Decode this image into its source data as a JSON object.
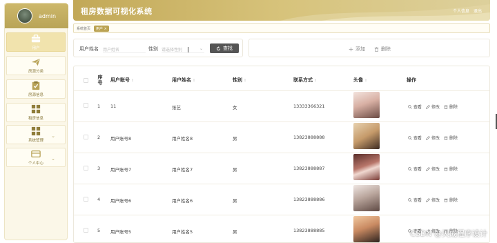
{
  "sidebar": {
    "username": "admin",
    "items": [
      {
        "label": "用户",
        "icon": "briefcase-icon"
      },
      {
        "label": "房源分类",
        "icon": "paper-plane-icon"
      },
      {
        "label": "房源信息",
        "icon": "clipboard-check-icon"
      },
      {
        "label": "租房信息",
        "icon": "grid-icon"
      },
      {
        "label": "系统管理",
        "icon": "grid-icon"
      },
      {
        "label": "个人中心",
        "icon": "card-icon"
      }
    ]
  },
  "header": {
    "title": "租房数据可视化系统",
    "profile_label": "个人信息",
    "logout_label": "退出"
  },
  "breadcrumb": {
    "home": "系统首页",
    "current_tag": "用户 ×"
  },
  "search": {
    "name_label": "用户姓名",
    "name_placeholder": "用户姓名",
    "gender_label": "性别",
    "gender_placeholder": "请选择性别",
    "search_button": "查找"
  },
  "actions": {
    "add": "添加",
    "delete": "删除"
  },
  "table": {
    "columns": [
      "序号",
      "用户账号",
      "用户姓名",
      "性别",
      "联系方式",
      "头像",
      "操作"
    ],
    "rows": [
      {
        "index": "1",
        "account": "11",
        "name": "张艺",
        "gender": "女",
        "phone": "13333366321",
        "avatar_color": "#d6a9a0"
      },
      {
        "index": "2",
        "account": "用户账号8",
        "name": "用户姓名8",
        "gender": "男",
        "phone": "13823888888",
        "avatar_color": "#c9a374"
      },
      {
        "index": "3",
        "account": "用户账号7",
        "name": "用户姓名7",
        "gender": "男",
        "phone": "13823888887",
        "avatar_color": "#7a3b35"
      },
      {
        "index": "4",
        "account": "用户账号6",
        "name": "用户姓名6",
        "gender": "男",
        "phone": "13823888886",
        "avatar_color": "#9b8c86"
      },
      {
        "index": "5",
        "account": "用户账号5",
        "name": "用户姓名5",
        "gender": "男",
        "phone": "13823888885",
        "avatar_color": "#b07050"
      }
    ],
    "row_actions": {
      "view": "查看",
      "edit": "修改",
      "delete": "删除"
    }
  },
  "watermark": "CSDN @天成程序设计"
}
